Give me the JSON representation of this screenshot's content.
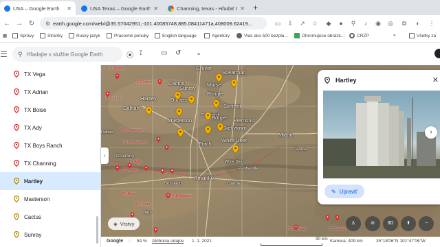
{
  "browser": {
    "tabs": [
      {
        "title": "USA – Google Earth",
        "active": true,
        "icon_color": "#1a73e8"
      },
      {
        "title": "USA Texas – Google Earth",
        "active": false,
        "icon_color": "#1a73e8"
      },
      {
        "title": "Channing, texas - Hľadať Goog",
        "active": false,
        "icon_color": "#ea4335"
      }
    ],
    "new_tab_label": "+",
    "url": "earth.google.com/web/@35.57042951,-101.40085748,885.08411471a,408009.62419...",
    "bookmarks": [
      {
        "label": "Správy",
        "icon": "folder-icon"
      },
      {
        "label": "Stránky",
        "icon": "folder-icon"
      },
      {
        "label": "Ruský jazyk",
        "icon": "folder-icon"
      },
      {
        "label": "Pracovné ponuky",
        "icon": "folder-icon"
      },
      {
        "label": "English language",
        "icon": "folder-icon"
      },
      {
        "label": "Agentúry",
        "icon": "folder-icon"
      },
      {
        "label": "Viac ako 500 bezpla...",
        "icon": "globe-icon"
      },
      {
        "label": "Ohromujúce obrázk...",
        "icon": "image-icon"
      },
      {
        "label": "CRZP",
        "icon": "gear-icon"
      },
      {
        "label": "Všetky zá",
        "icon": "folder-icon"
      }
    ]
  },
  "earth": {
    "search_placeholder": "Hľadajte v službe Google Earth",
    "sidebar_items": [
      {
        "label": "TX Vega",
        "selected": false,
        "pin": "red"
      },
      {
        "label": "TX Adrian",
        "selected": false,
        "pin": "red"
      },
      {
        "label": "TX Boise",
        "selected": false,
        "pin": "red"
      },
      {
        "label": "TX Ady",
        "selected": false,
        "pin": "red"
      },
      {
        "label": "TX Boys Ranch",
        "selected": false,
        "pin": "red"
      },
      {
        "label": "TX Channing",
        "selected": false,
        "pin": "red"
      },
      {
        "label": "Hartley",
        "selected": true,
        "pin": "yellow"
      },
      {
        "label": "Masterson",
        "selected": false,
        "pin": "yellow"
      },
      {
        "label": "Cactus",
        "selected": false,
        "pin": "yellow"
      },
      {
        "label": "Sunray",
        "selected": false,
        "pin": "yellow"
      }
    ],
    "map_labels": [
      "Gruver",
      "Spearman",
      "Cactus",
      "Sunray",
      "Morse",
      "Dalhart",
      "Hartley",
      "Dumas",
      "Pringle",
      "Stinnett",
      "Sanford",
      "Borger",
      "Plemons",
      "Masterson",
      "Skellytown",
      "Miami",
      "Fritch",
      "White Deer",
      "Channing",
      "Panhandle",
      "Pampa",
      "Bushland",
      "Amarillo",
      "Claude",
      "White Deer",
      "Dalhart",
      "Vega"
    ],
    "red_labels": [
      "TX Perico",
      "TX Conlen",
      "TX Dalhart",
      "TX Channing",
      "TX Boys Ranch",
      "TX Ady",
      "TX Adrian",
      "TX Vega",
      "TX Boise",
      "TX Wildorado",
      "TX Conway",
      "TX Groom"
    ],
    "layers_label": "Vrstvy",
    "status": {
      "provider": "Google",
      "progress_label": "84 %",
      "attribution": "Atribúcia údajov",
      "date": "1. 1. 2021",
      "scale": "90 km",
      "camera": "Kamera: 409 km",
      "coords": "35°18'06\"N 101°47'06\"W"
    },
    "map_controls": [
      "3D"
    ],
    "card": {
      "title": "Hartley",
      "edit_label": "Upraviť"
    }
  },
  "colors": {
    "pin_yellow": "#f6b400",
    "pin_red": "#c62828",
    "selected_bg": "#d7eaff",
    "accent": "#0b57d0"
  }
}
